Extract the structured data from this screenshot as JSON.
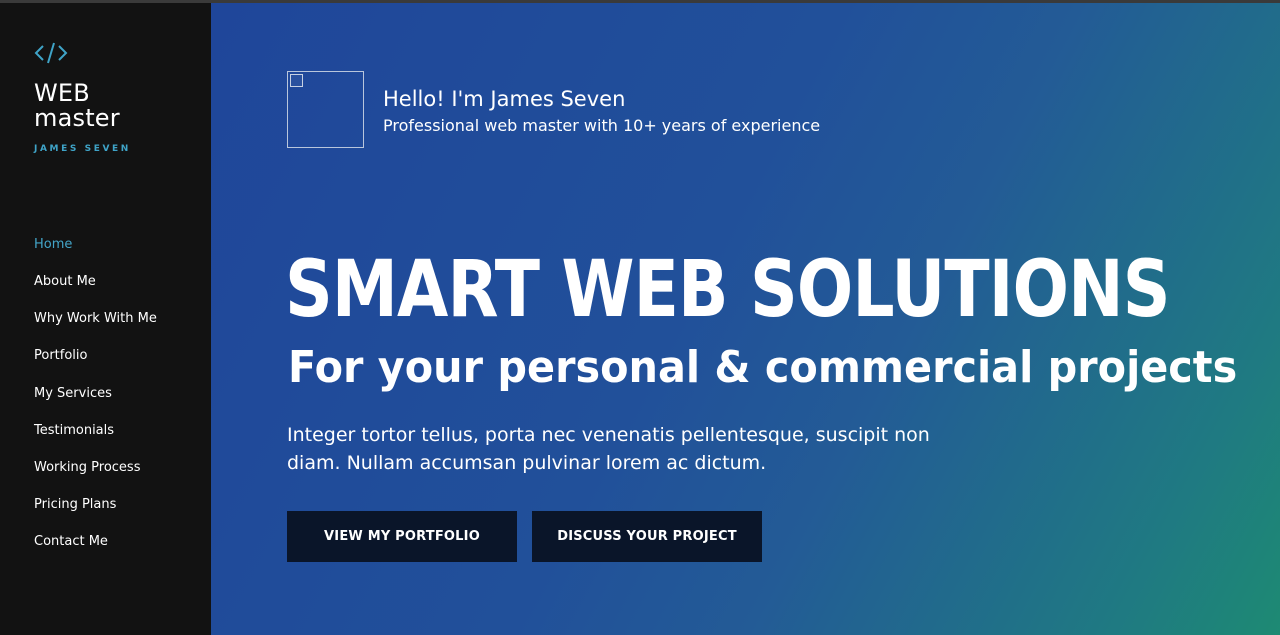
{
  "brand": {
    "icon": "code-icon",
    "name_line1": "WEB",
    "name_line2": "master",
    "subtitle": "JAMES SEVEN",
    "accent_color": "#3fa4c8"
  },
  "nav": {
    "items": [
      {
        "label": "Home",
        "active": true
      },
      {
        "label": "About Me",
        "active": false
      },
      {
        "label": "Why Work With Me",
        "active": false
      },
      {
        "label": "Portfolio",
        "active": false
      },
      {
        "label": "My Services",
        "active": false
      },
      {
        "label": "Testimonials",
        "active": false
      },
      {
        "label": "Working Process",
        "active": false
      },
      {
        "label": "Pricing Plans",
        "active": false
      },
      {
        "label": "Contact Me",
        "active": false
      }
    ]
  },
  "hero": {
    "greeting": "Hello! I'm James Seven",
    "tagline": "Professional web master with 10+ years of experience",
    "headline": "SMART WEB SOLUTIONS",
    "subheadline": "For your personal & commercial projects",
    "description": "Integer tortor tellus, porta nec venenatis pellentesque, suscipit non diam. Nullam accumsan pulvinar lorem ac dictum.",
    "buttons": {
      "portfolio": "VIEW MY PORTFOLIO",
      "project": "DISCUSS YOUR PROJECT"
    },
    "colors": {
      "gradient_start": "#1f469a",
      "gradient_end": "#1e8a73",
      "button_bg": "#0a1529"
    }
  }
}
